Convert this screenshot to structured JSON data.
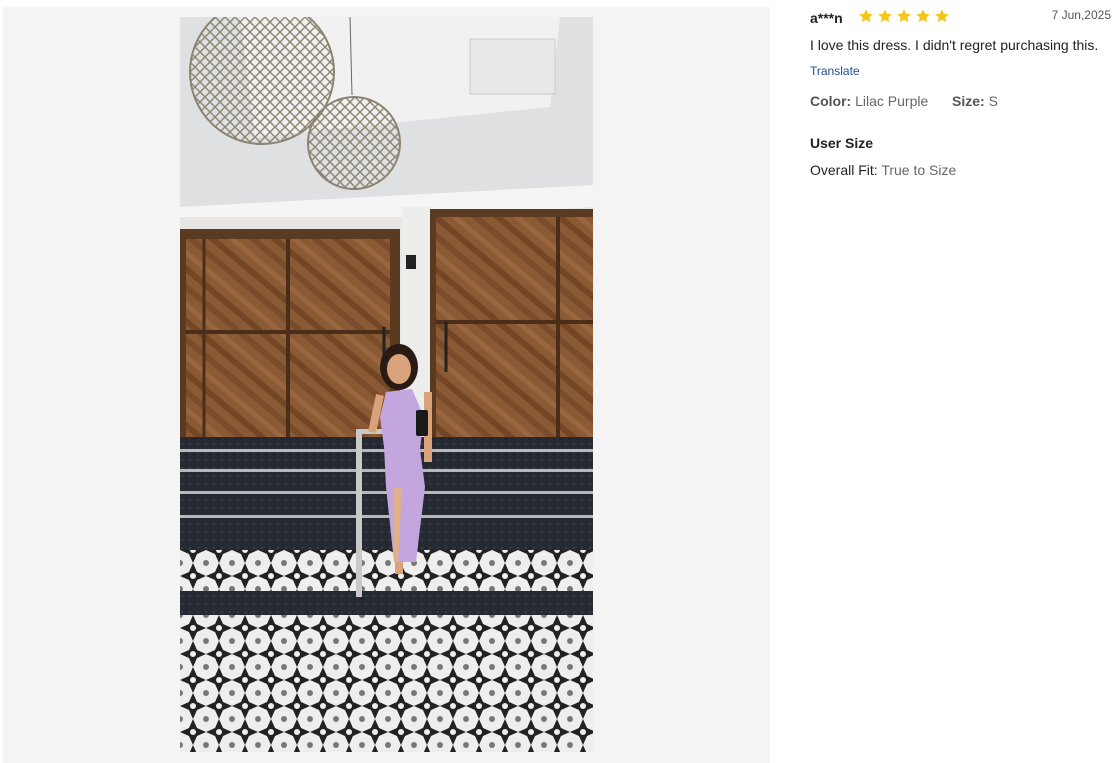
{
  "review": {
    "username": "a***n",
    "rating": 5,
    "rating_max": 5,
    "date": "7 Jun,2025",
    "text": "I love this dress. I didn't regret purchasing this.",
    "translate_label": "Translate",
    "color_label": "Color:",
    "color_value": "Lilac Purple",
    "size_label": "Size:",
    "size_value": "S",
    "user_size_title": "User Size",
    "fit_label": "Overall Fit:",
    "fit_value": "True to Size"
  },
  "colors": {
    "star": "#f5c518",
    "link": "#1e4f8f",
    "panel_bg": "#f4f4f4"
  },
  "icons": {
    "star": "star-icon"
  }
}
